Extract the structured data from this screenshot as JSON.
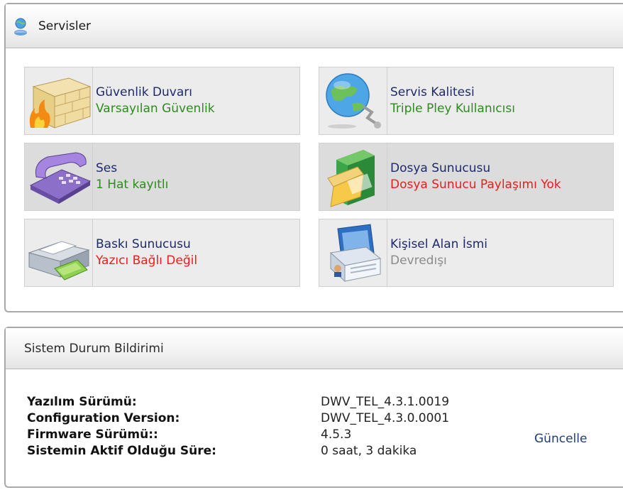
{
  "services": {
    "title": "Servisler",
    "tiles": [
      {
        "title": "Güvenlik Duvarı",
        "status": "Varsayılan Güvenlik",
        "icon": "firewall-icon"
      },
      {
        "title": "Servis Kalitesi",
        "status": "Triple Pley Kullanıcısı",
        "icon": "globe-network-icon"
      },
      {
        "title": "Ses",
        "status": "1 Hat kayıtlı",
        "icon": "telephone-icon"
      },
      {
        "title": "Dosya Sunucusu",
        "status": "Dosya Sunucu Paylaşımı Yok",
        "icon": "folder-icon"
      },
      {
        "title": "Baskı Sunucusu",
        "status": "Yazıcı Bağlı Değil",
        "icon": "printer-icon"
      },
      {
        "title": "Kişisel Alan İsmi",
        "status": "Devredışı",
        "icon": "id-card-icon"
      }
    ]
  },
  "status_panel": {
    "title": "Sistem Durum Bildirimi",
    "rows": [
      {
        "label": "Yazılım Sürümü:",
        "value": "DWV_TEL_4.3.1.0019"
      },
      {
        "label": "Configuration Version:",
        "value": "DWV_TEL_4.3.0.0001"
      },
      {
        "label": "Firmware Sürümü::",
        "value": "4.5.3"
      },
      {
        "label": "Sistemin Aktif Olduğu Süre:",
        "value": "0 saat, 3 dakika"
      }
    ],
    "update_link": "Güncelle"
  },
  "colors": {
    "ok": "#2e8b1f",
    "warn": "#ee1c1c",
    "disabled": "#8a8a8a",
    "title": "#1f2a6b"
  }
}
